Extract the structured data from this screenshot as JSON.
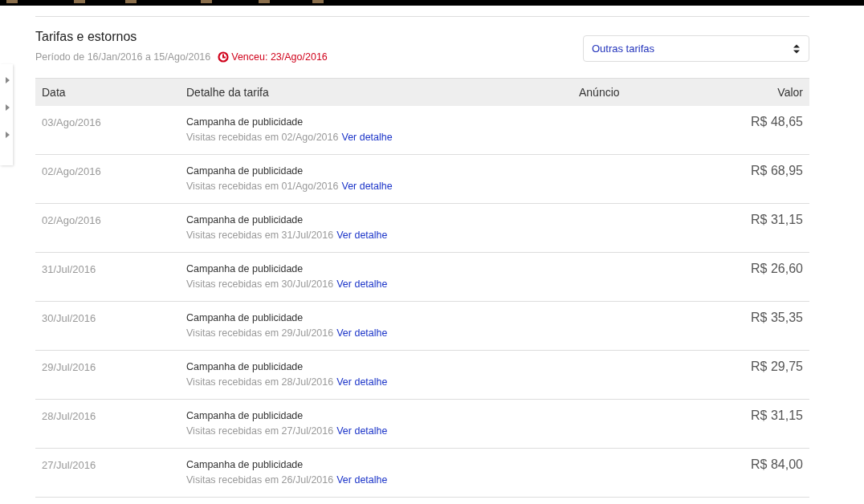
{
  "title": "Tarifas e estornos",
  "period": "Período de 16/Jan/2016 a 15/Ago/2016",
  "due": {
    "label": "Venceu: 23/Ago/2016",
    "overdue": true
  },
  "filter": {
    "value": "Outras tarifas"
  },
  "table": {
    "columns": [
      "Data",
      "Detalhe da tarifa",
      "Anúncio",
      "Valor"
    ],
    "rows": [
      {
        "date": "03/Ago/2016",
        "detail": "Campanha de publicidade",
        "sub": "Visitas recebidas em 02/Ago/2016",
        "link": "Ver detalhe",
        "value": "R$ 48,65"
      },
      {
        "date": "02/Ago/2016",
        "detail": "Campanha de publicidade",
        "sub": "Visitas recebidas em 01/Ago/2016",
        "link": "Ver detalhe",
        "value": "R$ 68,95"
      },
      {
        "date": "02/Ago/2016",
        "detail": "Campanha de publicidade",
        "sub": "Visitas recebidas em 31/Jul/2016",
        "link": "Ver detalhe",
        "value": "R$ 31,15"
      },
      {
        "date": "31/Jul/2016",
        "detail": "Campanha de publicidade",
        "sub": "Visitas recebidas em 30/Jul/2016",
        "link": "Ver detalhe",
        "value": "R$ 26,60"
      },
      {
        "date": "30/Jul/2016",
        "detail": "Campanha de publicidade",
        "sub": "Visitas recebidas em 29/Jul/2016",
        "link": "Ver detalhe",
        "value": "R$ 35,35"
      },
      {
        "date": "29/Jul/2016",
        "detail": "Campanha de publicidade",
        "sub": "Visitas recebidas em 28/Jul/2016",
        "link": "Ver detalhe",
        "value": "R$ 29,75"
      },
      {
        "date": "28/Jul/2016",
        "detail": "Campanha de publicidade",
        "sub": "Visitas recebidas em 27/Jul/2016",
        "link": "Ver detalhe",
        "value": "R$ 31,15"
      },
      {
        "date": "27/Jul/2016",
        "detail": "Campanha de publicidade",
        "sub": "Visitas recebidas em 26/Jul/2016",
        "link": "Ver detalhe",
        "value": "R$ 84,00"
      }
    ]
  }
}
